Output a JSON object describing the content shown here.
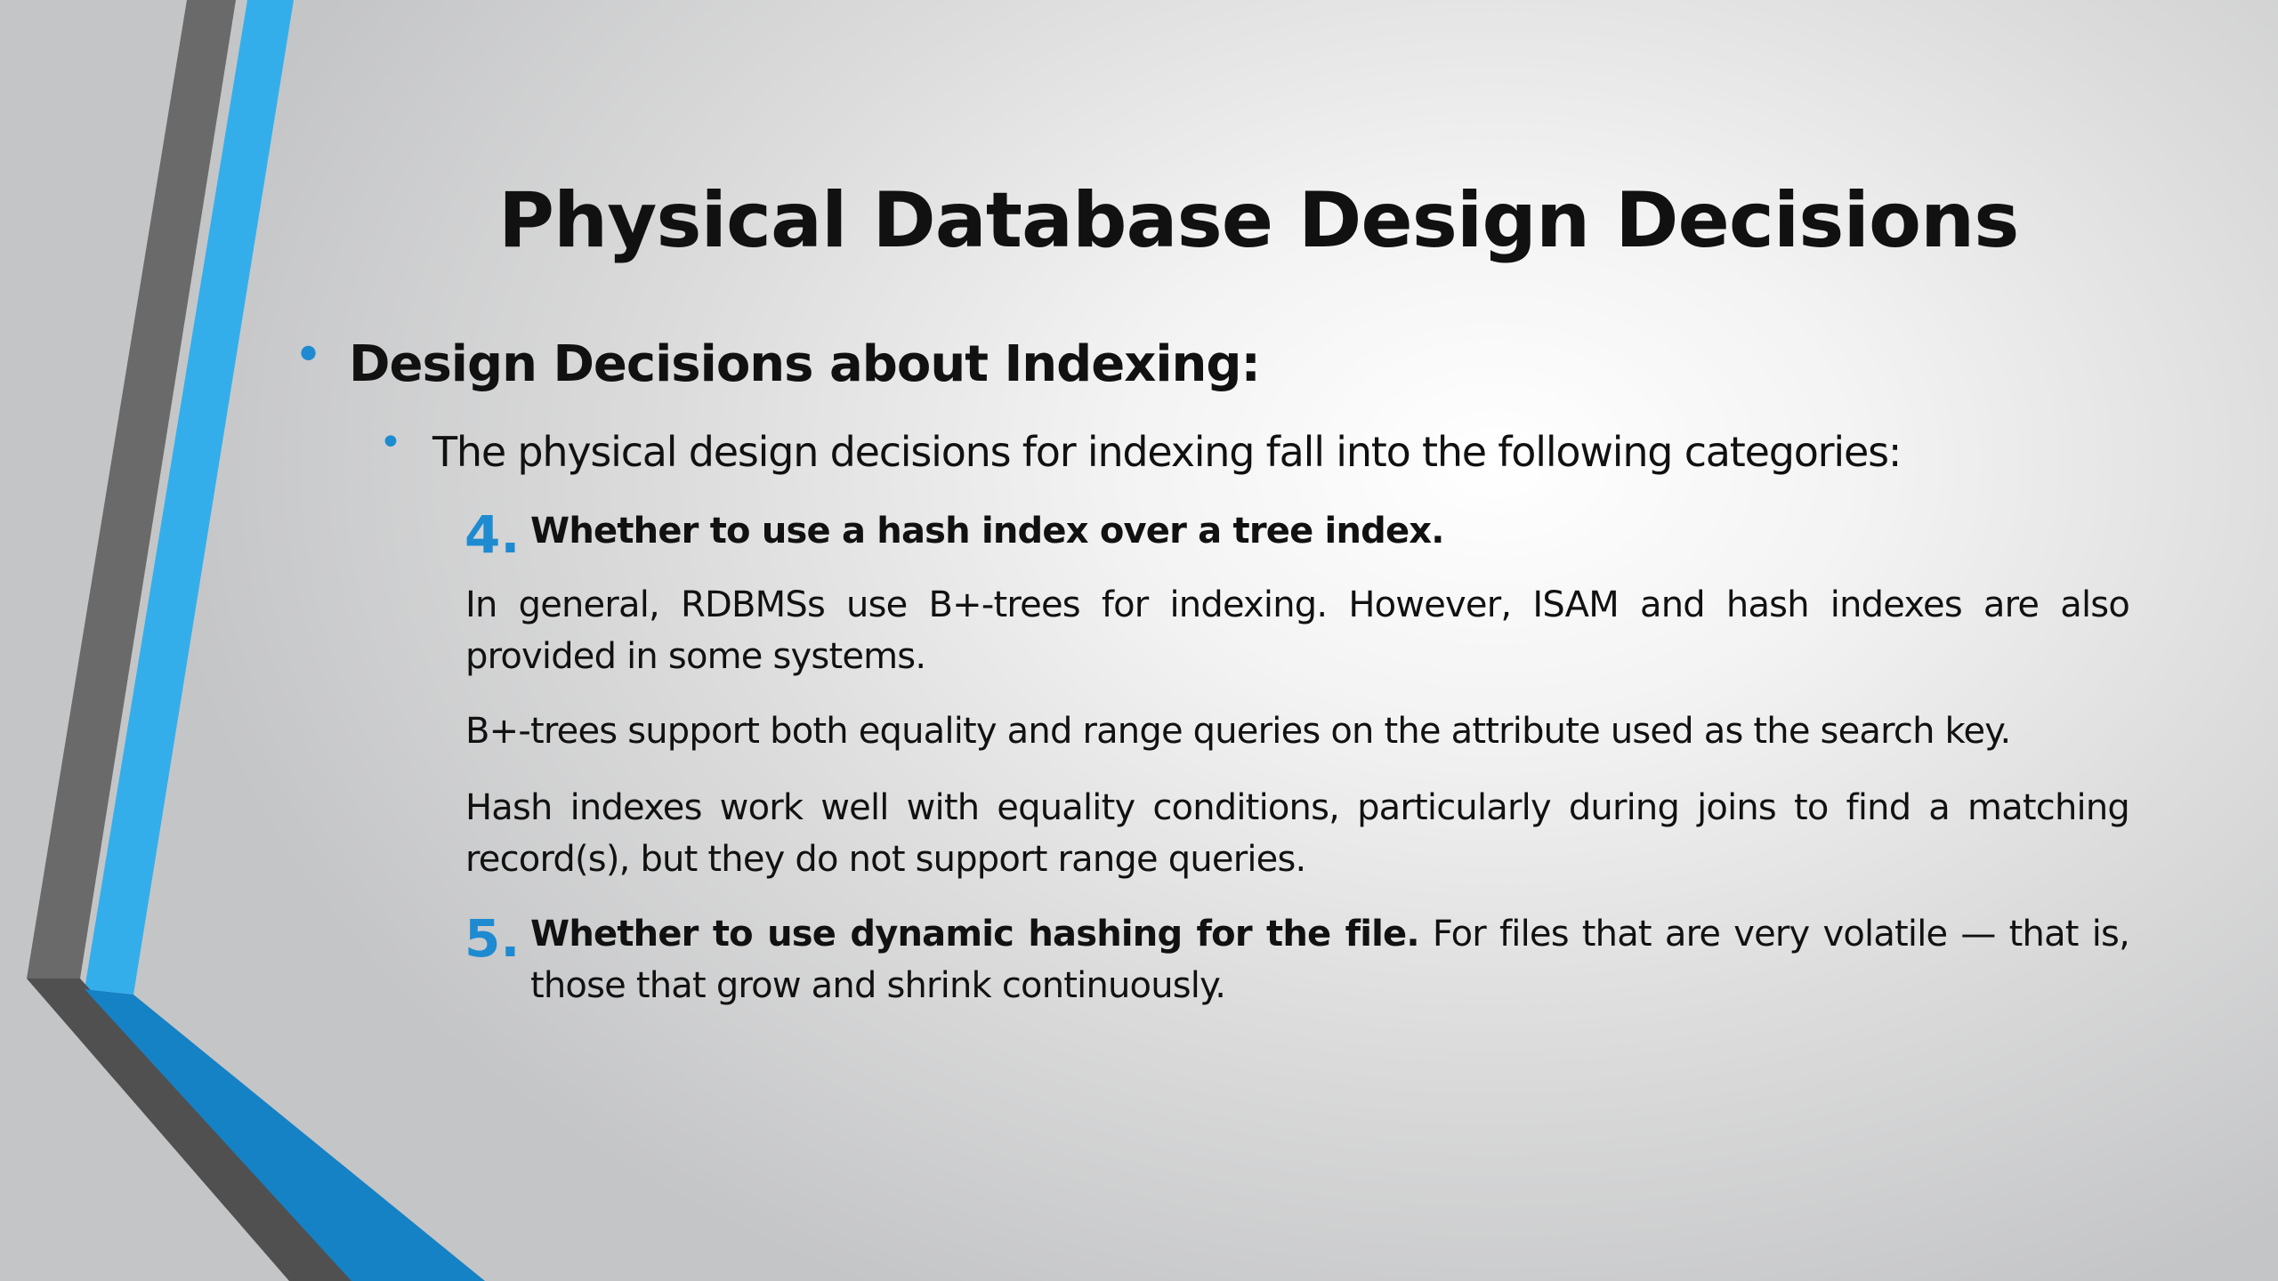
{
  "slide": {
    "title": "Physical Database Design Decisions",
    "bullet_l1": "Design Decisions about Indexing:",
    "bullet_l2": "The physical design decisions for indexing fall into the following categories:",
    "item4": {
      "number": "4.",
      "heading": "Whether to use a hash index over a tree index.",
      "paragraphs": [
        "In general, RDBMSs use B+-trees for indexing. However, ISAM and hash indexes are also provided in some systems.",
        "B+-trees support both equality and range queries on the attribute used as the search key.",
        "Hash indexes work well with equality conditions, particularly during joins to find a matching record(s), but they do not support range queries."
      ]
    },
    "item5": {
      "number": "5.",
      "heading": "Whether to use dynamic hashing for the file.",
      "text": "For files that are very volatile — that is, those that grow and shrink continuously."
    },
    "bullet_glyph": "•"
  },
  "theme": {
    "accent_blue": "#1e8bd1",
    "bright_blue": "#33aee8",
    "dark_gray": "#5e5e5e",
    "text_color": "#111111"
  }
}
